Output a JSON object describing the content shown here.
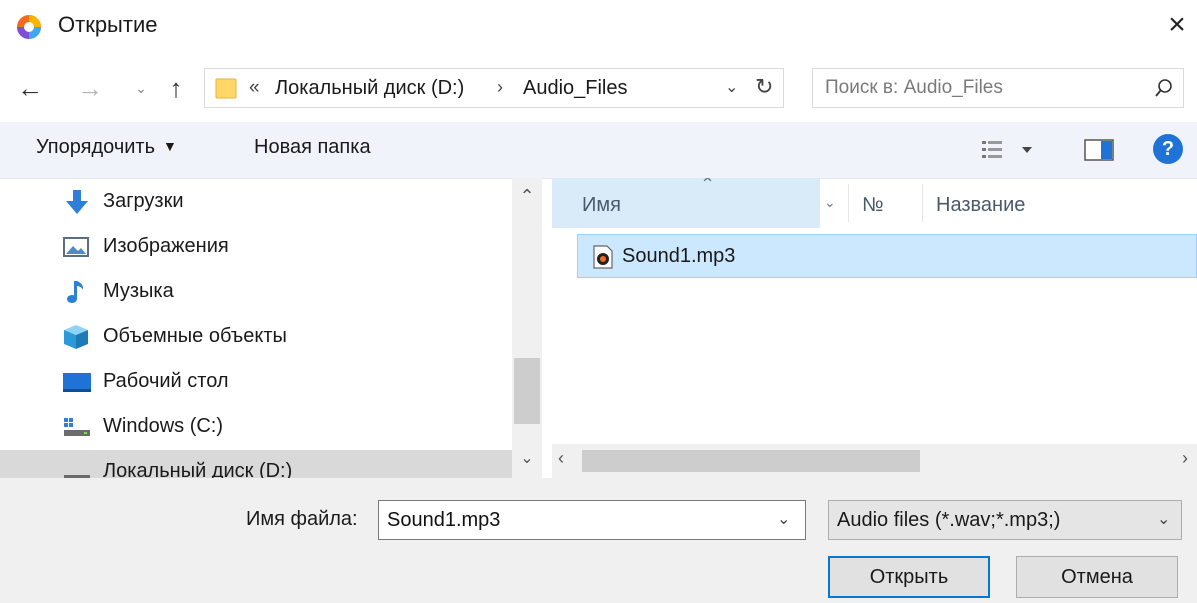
{
  "window": {
    "title": "Открытие"
  },
  "address": {
    "chevron": "«",
    "crumbs": [
      "Локальный диск (D:)",
      "Audio_Files"
    ],
    "separator": "›"
  },
  "search": {
    "placeholder": "Поиск в: Audio_Files"
  },
  "toolbar": {
    "organize_label": "Упорядочить",
    "new_folder_label": "Новая папка",
    "help_label": "?"
  },
  "nav": {
    "items": [
      {
        "label": "Загрузки",
        "icon": "download-icon"
      },
      {
        "label": "Изображения",
        "icon": "pictures-icon"
      },
      {
        "label": "Музыка",
        "icon": "music-icon"
      },
      {
        "label": "Объемные объекты",
        "icon": "3d-objects-icon"
      },
      {
        "label": "Рабочий стол",
        "icon": "desktop-icon"
      },
      {
        "label": "Windows (C:)",
        "icon": "windows-drive-icon"
      },
      {
        "label": "Локальный диск (D:)",
        "icon": "drive-icon"
      }
    ]
  },
  "columns": {
    "name": "Имя",
    "number": "№",
    "title": "Название"
  },
  "files": [
    {
      "name": "Sound1.mp3",
      "icon": "mp3-file-icon"
    }
  ],
  "bottom": {
    "filename_label": "Имя файла:",
    "filename_value": "Sound1.mp3",
    "filetype_value": "Audio files (*.wav;*.mp3;)",
    "open_label": "Открыть",
    "cancel_label": "Отмена"
  },
  "colors": {
    "accent": "#0078d7",
    "selection": "#cce8ff",
    "header_highlight": "#d9ebf9",
    "toolbar_bg": "#f0f3f9",
    "help": "#1f73d6"
  }
}
